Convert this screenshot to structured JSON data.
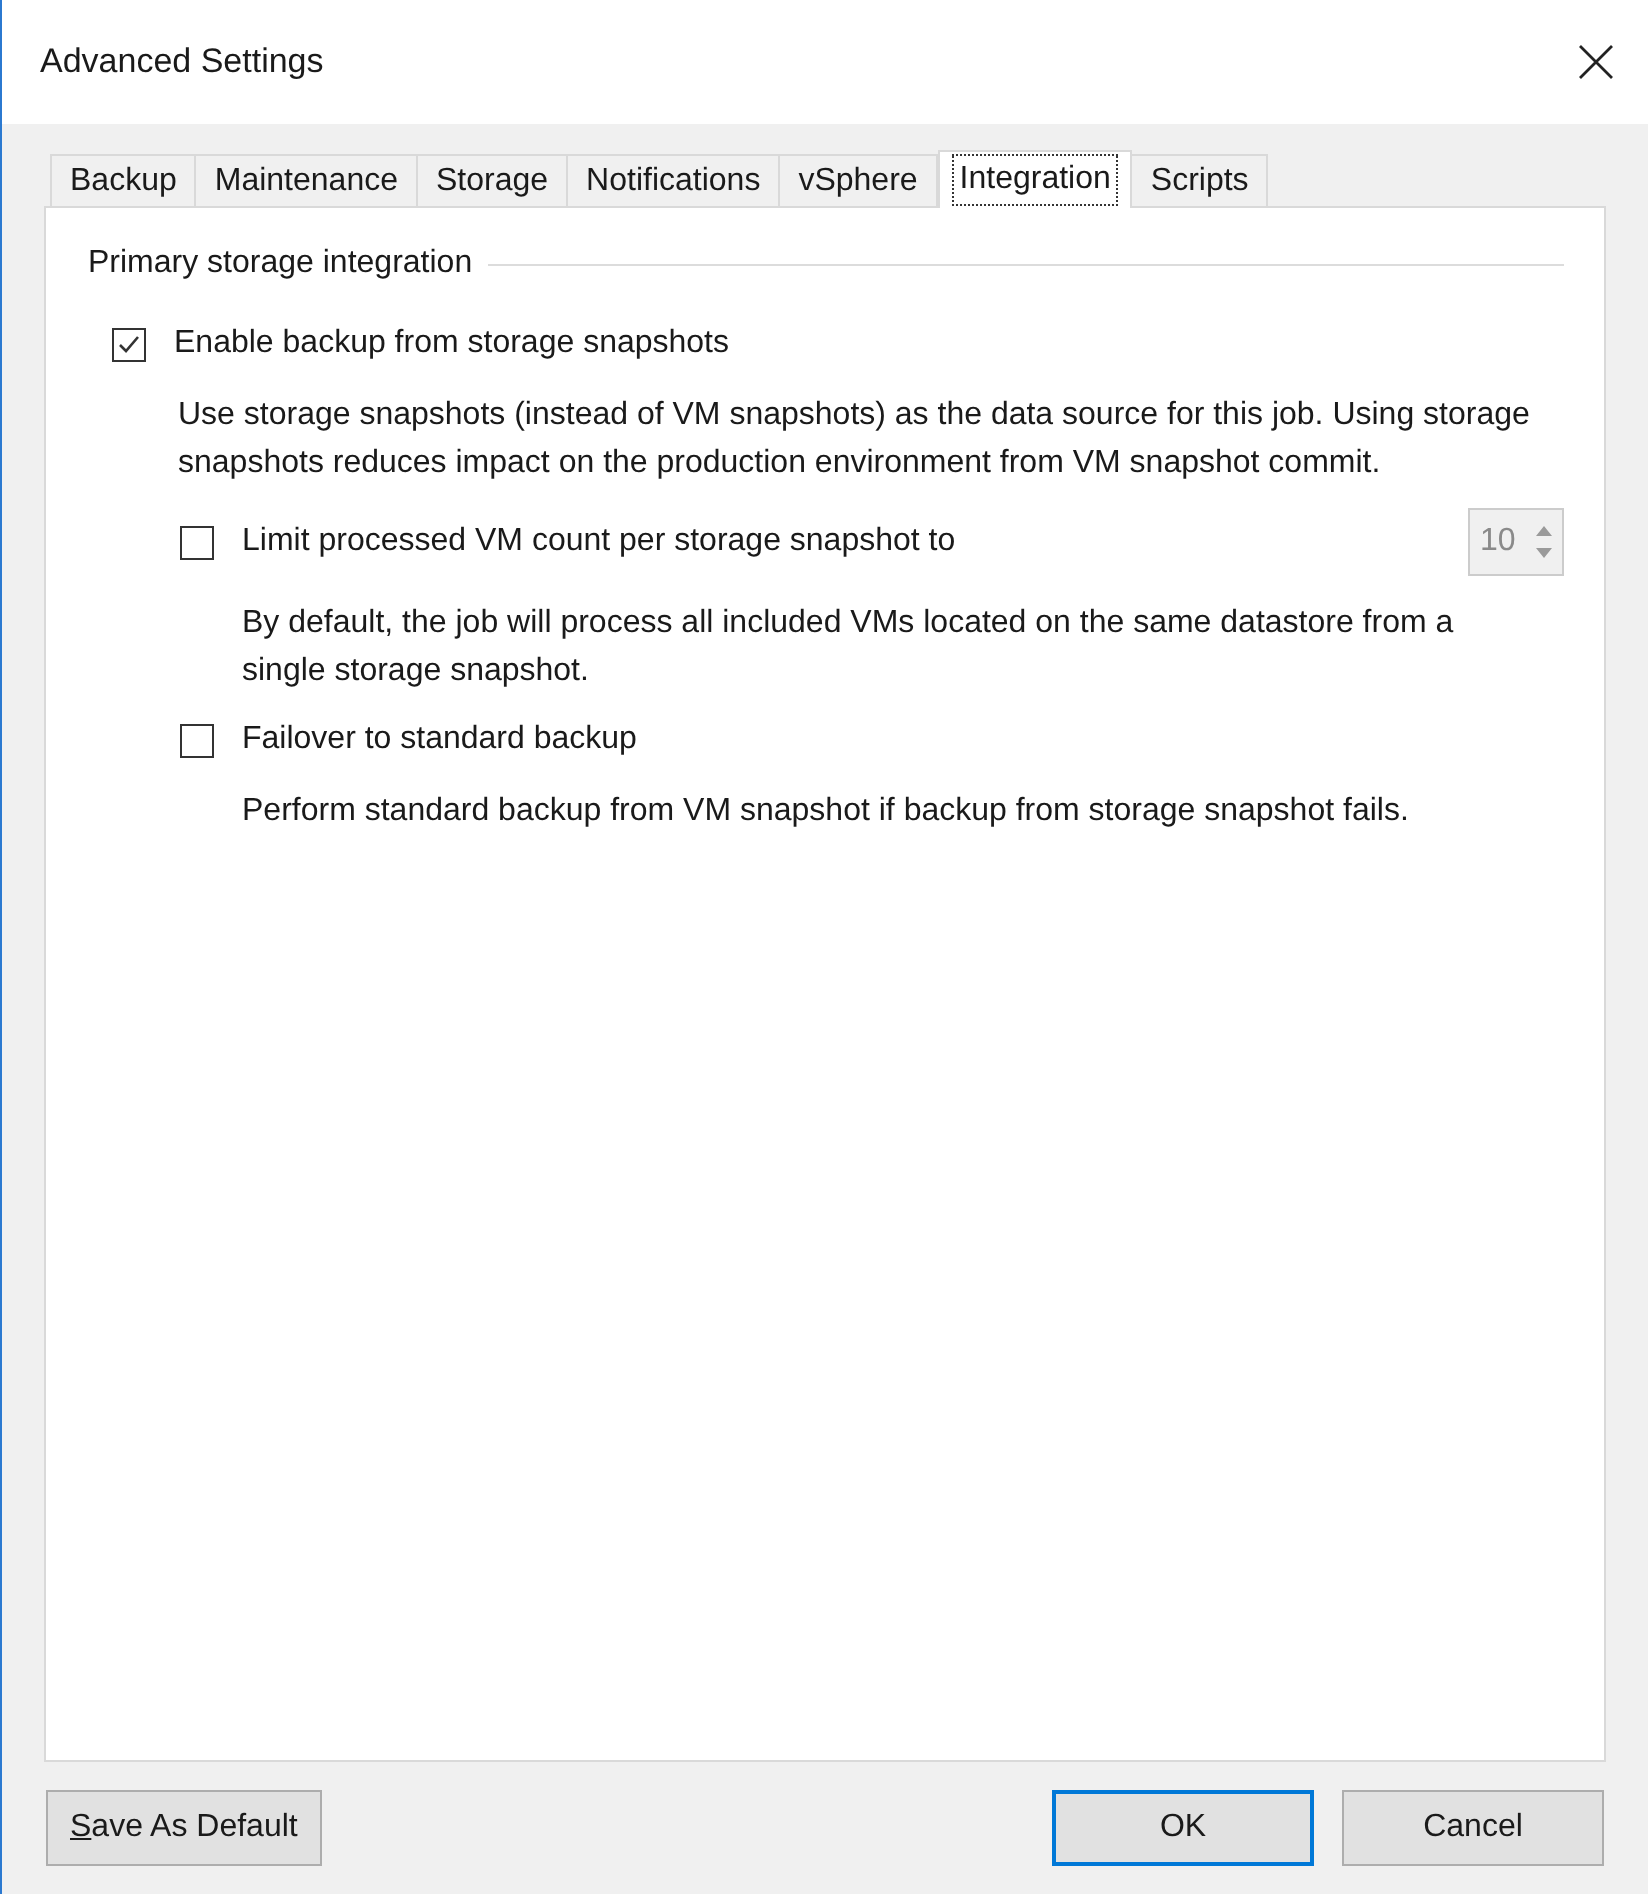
{
  "window": {
    "title": "Advanced Settings"
  },
  "tabs": [
    {
      "label": "Backup",
      "selected": false
    },
    {
      "label": "Maintenance",
      "selected": false
    },
    {
      "label": "Storage",
      "selected": false
    },
    {
      "label": "Notifications",
      "selected": false
    },
    {
      "label": "vSphere",
      "selected": false
    },
    {
      "label": "Integration",
      "selected": true
    },
    {
      "label": "Scripts",
      "selected": false
    }
  ],
  "group": {
    "title": "Primary storage integration",
    "enable": {
      "label": "Enable backup from storage snapshots",
      "checked": true,
      "description": "Use storage snapshots (instead of VM snapshots) as the data source for this job. Using storage snapshots reduces impact on the production environment from VM snapshot commit."
    },
    "options": [
      {
        "label": "Limit processed VM count per storage snapshot to",
        "checked": false,
        "description": "By default, the job will process all included VMs located on the same datastore from a single storage snapshot.",
        "spinner": {
          "value": "10",
          "disabled": true
        }
      },
      {
        "label": "Failover to standard backup",
        "checked": false,
        "description": "Perform standard backup from VM snapshot if backup from storage snapshot fails."
      }
    ]
  },
  "buttons": {
    "left": "Save As Default",
    "ok": "OK",
    "cancel": "Cancel"
  }
}
